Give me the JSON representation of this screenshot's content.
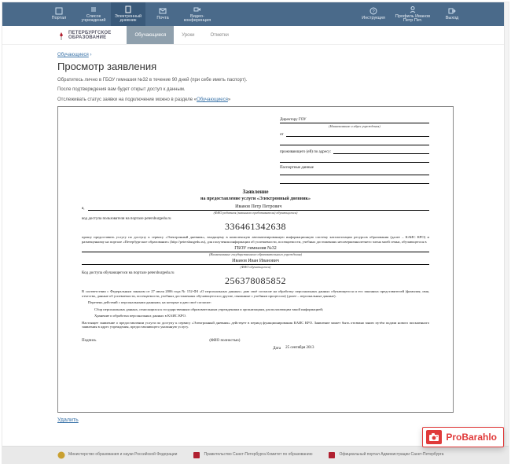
{
  "topnav": {
    "items": [
      {
        "label": "Портал",
        "icon": "portal"
      },
      {
        "label": "Список учреждений",
        "icon": "list"
      },
      {
        "label": "Электронный дневник",
        "icon": "diary",
        "active": true
      },
      {
        "label": "Почта",
        "icon": "mail"
      },
      {
        "label": "Видео-конференция",
        "icon": "video"
      }
    ],
    "right_items": [
      {
        "label": "Инструкция",
        "icon": "help"
      },
      {
        "label": "Профиль Иванов Петр Пет.",
        "icon": "profile"
      },
      {
        "label": "Выход",
        "icon": "exit"
      }
    ]
  },
  "brand": {
    "line1": "ПЕТЕРБУРГСКОЕ",
    "line2": "ОБРАЗОВАНИЕ"
  },
  "header_tabs": [
    {
      "label": "Обучающиеся",
      "active": true
    },
    {
      "label": "Уроки"
    },
    {
      "label": "Отметки"
    }
  ],
  "breadcrumb": {
    "link": "Обучающиеся",
    "sep": "›"
  },
  "page_title": "Просмотр заявления",
  "intro": {
    "line1": "Обратитесь лично в ГБОУ гимназия №32 в течение 90 дней (при себе иметь паспорт).",
    "line2": "После подтверждения вам будет открыт доступ к данным.",
    "line3_a": "Отслеживать статус заявки на подключение можно в разделе «",
    "line3_link": "Обучающиеся",
    "line3_b": "»"
  },
  "document": {
    "to_label": "Директору ГОУ",
    "to_caption": "(Наименование и адрес учреждения)",
    "from_label": "от",
    "addr_label": "проживающего (ей) по адресу:",
    "passport_label": "Паспортные данные",
    "title": "Заявление",
    "subtitle": "на предоставление услуги «Электронный дневник»",
    "ya": "я,",
    "parent_name": "Иванов Петр Петрович",
    "parent_caption": "(ФИО родителя (законного представителя) обучающегося)",
    "portal_login_label": "код доступа пользователя на портале petersburgedu.ru",
    "code1": "336461342638",
    "request_para": "прошу предоставить услугу по доступу к сервису «Электронный дневник», входящему в комплексную автоматизированную информационную систему каталогизации ресурсов образования (далее – КАИС КРО) и размещенному на портале «Петербургское образование» (http://petersburgedu.ru), для получения информации об успеваемости, посещаемости, учебных достижениях несовершеннолетнего члена моей семьи, обучающегося в",
    "school_name": "ГБОУ гимназия №32",
    "school_caption": "(Наименование государственного образовательного учреждения)",
    "student_name": "Иванов Иван Иванович",
    "student_caption": "(ФИО обучающегося)",
    "student_code_label": "Код доступа обучающегося на портале petersburgedu.ru",
    "code2": "256378085852",
    "consent_para": "В соответствии с Федеральным законом от 27 июля 2006 года № 152-ФЗ «О персональных данных» даю своё согласие на обработку персональных данных обучающегося и его законных представителей (фамилия, имя, отчество, данные об успеваемости, посещаемости, учебных достижениях обучающегося и другие, связанные с учебным процессом) (далее – персональные данные).",
    "actions_intro": "Перечень действий с персональными данными, на которые я даю своё согласие:",
    "action1": "Сбор персональных данных, относящихся к государственным образовательным учреждениям и организациям, располагающим такой информацией;",
    "action2": "Хранение и обработка персональных данных в КАИС КРО.",
    "validity_para": "Настоящее заявление о предоставлении услуги по доступу к сервису «Электронный дневник» действует в период функционирования КАИС КРО. Заявление может быть отозвано мною путём подачи нового письменного заявления в адрес учреждения, предоставляющего указанную услугу.",
    "signature_label": "Подпись",
    "signature_caption": "(ФИО полностью)",
    "date_label": "Дата",
    "date_value": "25 сентября 2013"
  },
  "delete_link": "Удалить",
  "footer": [
    {
      "label": "Министерство образования и науки Российской Федерации",
      "icon": "crest-ru"
    },
    {
      "label": "Правительство Санкт-Петербурга Комитет по образованию",
      "icon": "crest-spb"
    },
    {
      "label": "Официальный портал Администрации Санкт-Петербурга",
      "icon": "crest-admin"
    }
  ],
  "float_badge": {
    "text": "ProBarahlo"
  }
}
